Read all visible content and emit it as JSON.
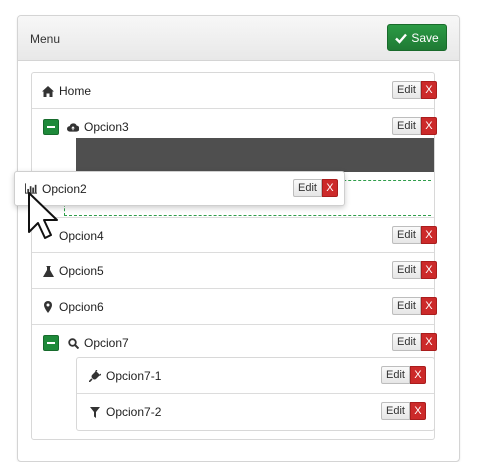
{
  "panel": {
    "title": "Menu",
    "save_label": "Save"
  },
  "actions": {
    "edit_label": "Edit",
    "delete_label": "X"
  },
  "items": [
    {
      "label": "Home",
      "icon": "home-icon"
    },
    {
      "label": "Opcion3",
      "icon": "cloud-upload-icon",
      "expanded": true
    },
    {
      "label": "Opcion4",
      "icon": "unknown-icon"
    },
    {
      "label": "Opcion5",
      "icon": "flask-icon"
    },
    {
      "label": "Opcion6",
      "icon": "map-marker-icon"
    },
    {
      "label": "Opcion7",
      "icon": "search-icon",
      "expanded": true,
      "children": [
        {
          "label": "Opcion7-1",
          "icon": "plug-icon"
        },
        {
          "label": "Opcion7-2",
          "icon": "filter-icon"
        }
      ]
    }
  ],
  "dragging": {
    "label": "Opcion2",
    "icon": "bar-chart-icon"
  },
  "colors": {
    "save": "#1f7a34",
    "delete": "#cc2a2a",
    "collapse": "#1e8a3a",
    "drop_placeholder": "#2f9e4a"
  }
}
